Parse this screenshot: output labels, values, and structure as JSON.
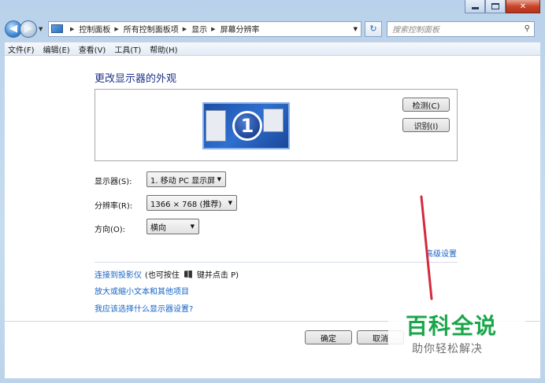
{
  "window": {
    "minimize_symbol": "",
    "close_symbol": "✕"
  },
  "nav": {
    "back_symbol": "◀",
    "forward_symbol": "▶",
    "breadcrumbs": [
      "控制面板",
      "所有控制面板项",
      "显示",
      "屏幕分辨率"
    ],
    "refresh_symbol": "↻",
    "search_placeholder": "搜索控制面板",
    "search_symbol": "⚲"
  },
  "menu": [
    "文件(F)",
    "编辑(E)",
    "查看(V)",
    "工具(T)",
    "帮助(H)"
  ],
  "main": {
    "title": "更改显示器的外观",
    "monitor_number": "1",
    "detect_button": "检测(C)",
    "identify_button": "识别(I)",
    "display_label": "显示器(S):",
    "display_value": "1. 移动 PC 显示屏",
    "resolution_label": "分辨率(R):",
    "resolution_value": "1366 × 768 (推荐)",
    "orientation_label": "方向(O):",
    "orientation_value": "横向",
    "advanced_link": "高级设置",
    "projector_link": "连接到投影仪",
    "projector_hint_before": "(也可按住",
    "projector_hint_after": "键并点击 P)",
    "text_size_link": "放大或缩小文本和其他项目",
    "which_settings_link": "我应该选择什么显示器设置?"
  },
  "footer": {
    "ok_button": "确定",
    "cancel_button": "取消"
  },
  "watermark": {
    "title": "百科全说",
    "subtitle": "助你轻松解决"
  },
  "colors": {
    "link": "#1563c4",
    "title": "#1e3287",
    "watermark_green": "#1aa64a",
    "annotation_red": "#d42a3c"
  }
}
